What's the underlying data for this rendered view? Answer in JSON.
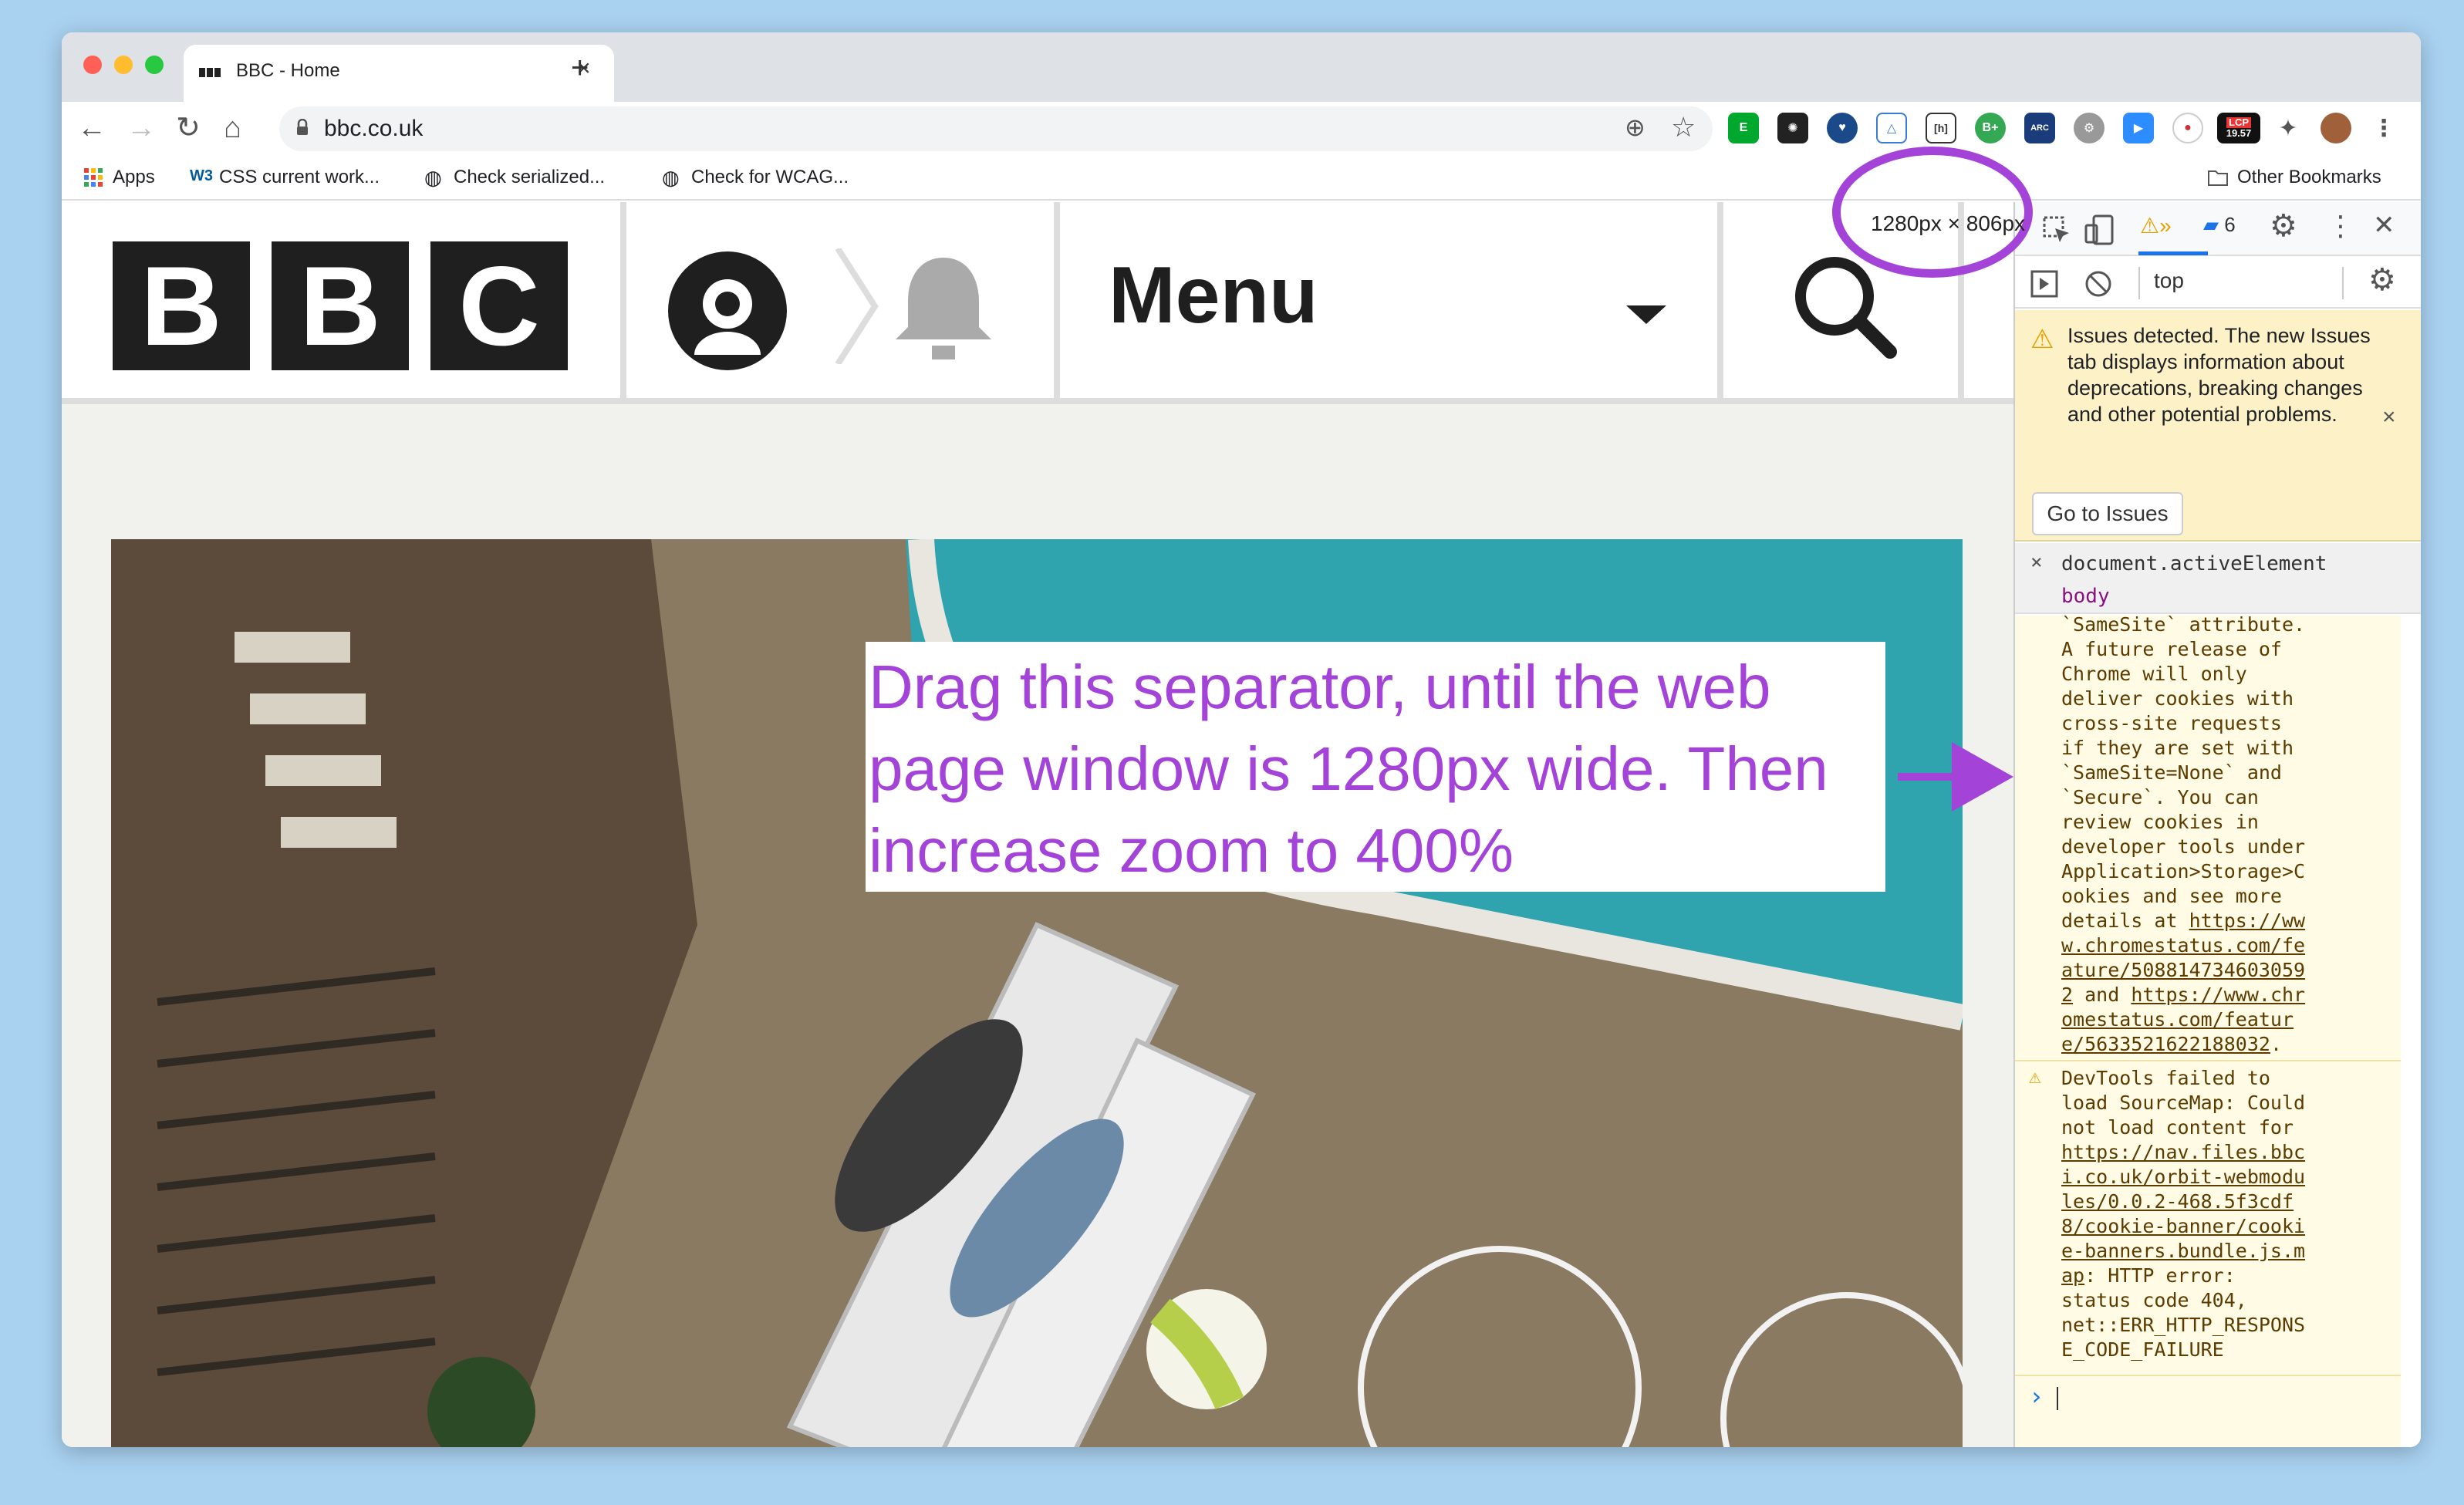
{
  "browser": {
    "tab_title": "BBC - Home",
    "tab_close": "×",
    "new_tab": "+",
    "url": "bbc.co.uk",
    "nav": {
      "back": "←",
      "forward": "→",
      "reload": "↻",
      "home": "⌂"
    },
    "extension_badge": "19.57",
    "extension_badge_top": "LCP",
    "extension_arc": "ARC",
    "bookmarks": [
      {
        "label": "Apps",
        "icon": "apps-grid-icon"
      },
      {
        "label": "CSS current work...",
        "icon": "w3c-icon"
      },
      {
        "label": "Check serialized...",
        "icon": "globe-icon"
      },
      {
        "label": "Check for WCAG...",
        "icon": "globe-icon"
      }
    ],
    "other_bookmarks": "Other Bookmarks"
  },
  "page": {
    "logo_letters": [
      "B",
      "B",
      "C"
    ],
    "menu_label": "Menu"
  },
  "devtools": {
    "dimensions": "1280px × 806px",
    "issue_count": "6",
    "context": "top",
    "issues_banner": "Issues detected. The new Issues tab displays information about deprecations, breaking changes and other potential problems.",
    "go_to_issues": "Go to Issues",
    "watch_expression": "document.activeElement",
    "watch_value": "body",
    "console_lines_1": [
      "`SameSite` attribute.",
      "A future release of",
      "Chrome will only",
      "deliver cookies with",
      "cross-site requests",
      "if they are set with",
      "`SameSite=None` and",
      "`Secure`. You can",
      "review cookies in",
      "developer tools under",
      "Application>Storage>C",
      "ookies and see more",
      "details at "
    ],
    "console_link_1a": "https://ww",
    "console_link_1b": [
      "w.chromestatus.com/fe",
      "ature/508814734603059",
      "2"
    ],
    "console_and": " and ",
    "console_link_1c": "https://www.chr",
    "console_link_1d": [
      "omestatus.com/featur",
      "e/5633521622188032"
    ],
    "console_line_dot": ".",
    "console_msg2_lines": [
      "DevTools failed to",
      "load SourceMap: Could",
      "not load content for"
    ],
    "console_link_2": [
      "https://nav.files.bbc",
      "i.co.uk/orbit-webmodu",
      "les/0.0.2-468.5f3cdf",
      "8/cookie-banner/cooki",
      "e-banners.bundle.js.m",
      "ap"
    ],
    "console_msg2_tail": [
      ": HTTP error:",
      "status code 404,",
      "net::ERR_HTTP_RESPONS",
      "E_CODE_FAILURE"
    ],
    "prompt": "›"
  },
  "annotation": {
    "instruction": "Drag this separator, until the web page window is 1280px wide. Then increase zoom to 400%"
  },
  "colors": {
    "annotation_purple": "#a443d8",
    "bbc_black": "#1f1f1f",
    "issues_yellow": "#fdf1c7"
  }
}
